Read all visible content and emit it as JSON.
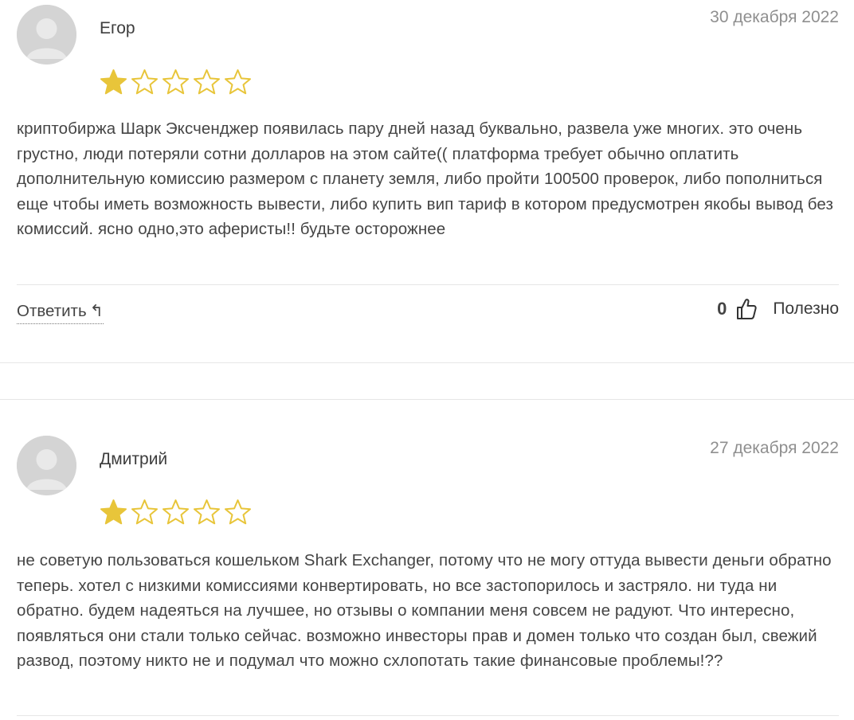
{
  "reviews": [
    {
      "author": "Егор",
      "date": "30 декабря 2022",
      "rating": 1,
      "max_rating": 5,
      "text": "криптобиржа Шарк Эксченджер появилась пару дней назад буквально, развела уже многих. это очень грустно, люди потеряли сотни долларов на этом сайте(( платформа требует обычно оплатить дополнительную комиссию размером с планету земля, либо пройти 100500 проверок, либо пополниться еще чтобы иметь возможность вывести, либо купить вип тариф в котором предусмотрен якобы вывод без комиссий. ясно одно,это аферисты!! будьте осторожнее",
      "reply_label": "Ответить",
      "helpful_count": "0",
      "helpful_label": "Полезно"
    },
    {
      "author": "Дмитрий",
      "date": "27 декабря 2022",
      "rating": 1,
      "max_rating": 5,
      "text": "не советую пользоваться кошельком Shark Exchanger, потому что не могу оттуда вывести деньги обратно теперь. хотел с низкими комиссиями конвертировать, но все застопорилось и застряло. ни туда ни обратно. будем надеяться на лучшее, но отзывы о компании меня совсем не радуют. Что интересно, появляться они стали только сейчас. возможно инвесторы прав и домен только что создан был, свежий развод, поэтому никто не и подумал что можно схлопотать такие финансовые проблемы!??"
    }
  ],
  "icons": {
    "avatar": "user-silhouette-icon",
    "star": "star-icon",
    "reply": "reply-arrow-icon",
    "thumb": "thumbs-up-icon"
  },
  "colors": {
    "star_fill": "#e8c53a",
    "star_outline": "#e8c53a",
    "date": "#8f8f8f",
    "divider": "#e6e6e6"
  }
}
